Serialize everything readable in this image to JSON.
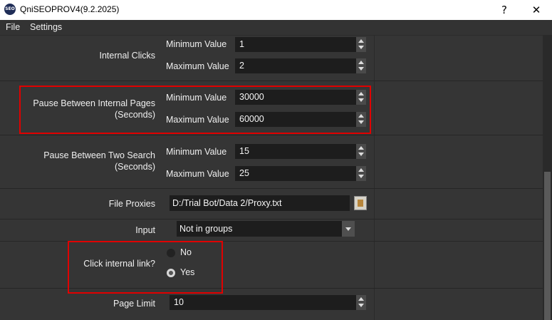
{
  "window": {
    "app_icon_text": "SEO",
    "title": "QniSEOPROV4(9.2.2025)",
    "help_label": "?",
    "close_label": "✕"
  },
  "menu": {
    "file": "File",
    "settings": "Settings"
  },
  "rows": {
    "internal_clicks": {
      "label": "Internal Clicks",
      "min_label": "Minimum Value",
      "min_value": "1",
      "max_label": "Maximum Value",
      "max_value": "2"
    },
    "pause_internal": {
      "label_line1": "Pause Between Internal Pages",
      "label_line2": "(Seconds)",
      "min_label": "Minimum Value",
      "min_value": "30000",
      "max_label": "Maximum Value",
      "max_value": "60000"
    },
    "pause_search": {
      "label_line1": "Pause Between Two Search",
      "label_line2": "(Seconds)",
      "min_label": "Minimum Value",
      "min_value": "15",
      "max_label": "Maximum Value",
      "max_value": "25"
    },
    "file_proxies": {
      "label": "File Proxies",
      "value": "D:/Trial Bot/Data 2/Proxy.txt"
    },
    "input": {
      "label": "Input",
      "selected": "Not in groups"
    },
    "click_internal": {
      "label": "Click internal link?",
      "option_no": "No",
      "option_yes": "Yes",
      "selected": "Yes"
    },
    "page_limit": {
      "label": "Page Limit",
      "value": "10"
    }
  },
  "colors": {
    "highlight": "#e00000",
    "background": "#353535",
    "field": "#1d1d1d"
  }
}
